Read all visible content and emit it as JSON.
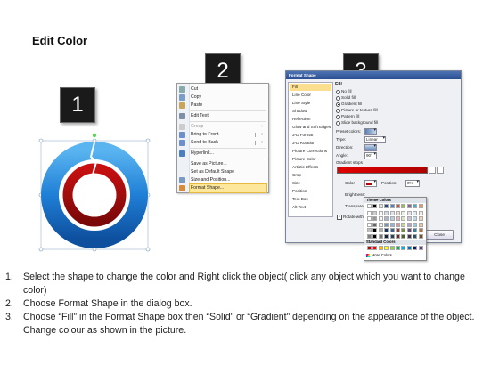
{
  "title": "Edit Color",
  "badges": [
    "1",
    "2",
    "3"
  ],
  "context_menu": {
    "items": [
      {
        "label": "Cut",
        "disabled": false
      },
      {
        "label": "Copy",
        "disabled": false
      },
      {
        "label": "Paste",
        "disabled": false
      },
      {
        "label": "Edit Text",
        "disabled": false
      },
      {
        "label": "Group",
        "disabled": true
      },
      {
        "label": "Bring to Front",
        "disabled": false
      },
      {
        "label": "Send to Back",
        "disabled": false
      },
      {
        "label": "Hyperlink...",
        "disabled": false
      },
      {
        "label": "Save as Picture...",
        "disabled": false
      },
      {
        "label": "Set as Default Shape",
        "disabled": false
      },
      {
        "label": "Size and Position...",
        "disabled": false
      },
      {
        "label": "Format Shape...",
        "disabled": false,
        "highlighted": true
      }
    ]
  },
  "dialog": {
    "title": "Format Shape",
    "categories": [
      "Fill",
      "Line Color",
      "Line Style",
      "Shadow",
      "Reflection",
      "Glow and Soft Edges",
      "3-D Format",
      "3-D Rotation",
      "Picture Corrections",
      "Picture Color",
      "Artistic Effects",
      "Crop",
      "Size",
      "Position",
      "Text Box",
      "Alt Text"
    ],
    "selected_category": "Fill",
    "section": "Fill",
    "fill_options": [
      "No fill",
      "Solid fill",
      "Gradient fill",
      "Picture or texture fill",
      "Pattern fill",
      "Slide background fill"
    ],
    "selected_fill": "Gradient fill",
    "preset_colors_label": "Preset colors:",
    "type_label": "Type:",
    "type_value": "Linear",
    "direction_label": "Direction:",
    "angle_label": "Angle:",
    "angle_value": "90°",
    "gradient_stops_label": "Gradient stops",
    "color_label": "Color",
    "position_label": "Position:",
    "position_value": "0%",
    "brightness_label": "Brightness:",
    "transparency_label": "Transparency:",
    "rotate_label": "Rotate with shape",
    "close_label": "Close"
  },
  "palette": {
    "theme_header": "Theme Colors",
    "standard_header": "Standard Colors",
    "more_colors": "More Colors...",
    "theme_top": [
      "#ffffff",
      "#000000",
      "#eeece1",
      "#1f497d",
      "#4f81bd",
      "#c0504d",
      "#9bbb59",
      "#8064a2",
      "#4bacc6",
      "#f79646"
    ],
    "standard": [
      "#c00000",
      "#ff0000",
      "#ffc000",
      "#ffff00",
      "#92d050",
      "#00b050",
      "#00b0f0",
      "#0070c0",
      "#002060",
      "#7030a0"
    ]
  },
  "instructions": [
    {
      "num": "1.",
      "text": "Select the shape to change the color and Right click the object( click any object which you want to change color)"
    },
    {
      "num": "2.",
      "text": "Choose Format Shape in the dialog box."
    },
    {
      "num": "3.",
      "text": "Choose “Fill” in the Format Shape box then “Solid” or “Gradient” depending on the appearance of the object. Change colour as shown in the picture."
    }
  ]
}
